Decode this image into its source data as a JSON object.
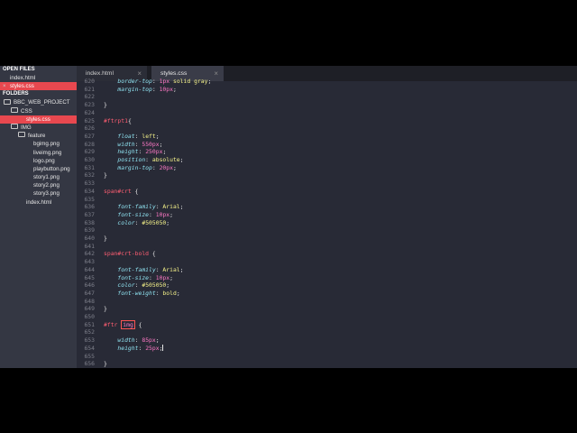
{
  "sidebar": {
    "open_files_header": "OPEN FILES",
    "open_files": [
      {
        "label": "index.html",
        "active": false
      },
      {
        "label": "styles.css",
        "active": true
      }
    ],
    "folders_header": "FOLDERS",
    "tree": [
      {
        "label": "BBC_WEB_PROJECT",
        "depth": 0,
        "type": "folder"
      },
      {
        "label": "CSS",
        "depth": 1,
        "type": "folder"
      },
      {
        "label": "styles.css",
        "depth": 2,
        "type": "file",
        "active": true
      },
      {
        "label": "IMG",
        "depth": 1,
        "type": "folder"
      },
      {
        "label": "feature",
        "depth": 2,
        "type": "folder"
      },
      {
        "label": "bgimg.png",
        "depth": 3,
        "type": "file"
      },
      {
        "label": "liveimg.png",
        "depth": 3,
        "type": "file"
      },
      {
        "label": "logo.png",
        "depth": 3,
        "type": "file"
      },
      {
        "label": "playbutton.png",
        "depth": 3,
        "type": "file"
      },
      {
        "label": "story1.png",
        "depth": 3,
        "type": "file"
      },
      {
        "label": "story2.png",
        "depth": 3,
        "type": "file"
      },
      {
        "label": "story3.png",
        "depth": 3,
        "type": "file"
      },
      {
        "label": "index.html",
        "depth": 2,
        "type": "file"
      }
    ]
  },
  "tabs": [
    {
      "label": "index.html",
      "active": false,
      "close": "×"
    },
    {
      "label": "styles.css",
      "active": true,
      "close": "×"
    }
  ],
  "editor": {
    "lines": [
      {
        "n": "620",
        "tokens": [
          [
            "prop",
            "    border-top"
          ],
          [
            "punc",
            ": "
          ],
          [
            "num",
            "1"
          ],
          [
            "unit",
            "px"
          ],
          [
            "val",
            " solid gray"
          ],
          [
            "punc",
            ";"
          ]
        ]
      },
      {
        "n": "621",
        "tokens": [
          [
            "prop",
            "    margin-top"
          ],
          [
            "punc",
            ": "
          ],
          [
            "num",
            "10"
          ],
          [
            "unit",
            "px"
          ],
          [
            "punc",
            ";"
          ]
        ]
      },
      {
        "n": "622",
        "tokens": []
      },
      {
        "n": "623",
        "tokens": [
          [
            "punc",
            "}"
          ]
        ]
      },
      {
        "n": "624",
        "tokens": []
      },
      {
        "n": "625",
        "tokens": [
          [
            "sel",
            "#ftrpt1"
          ],
          [
            "punc",
            "{"
          ]
        ]
      },
      {
        "n": "626",
        "tokens": []
      },
      {
        "n": "627",
        "tokens": [
          [
            "prop",
            "    float"
          ],
          [
            "punc",
            ": "
          ],
          [
            "val",
            "left"
          ],
          [
            "punc",
            ";"
          ]
        ]
      },
      {
        "n": "628",
        "tokens": [
          [
            "prop",
            "    width"
          ],
          [
            "punc",
            ": "
          ],
          [
            "num",
            "550"
          ],
          [
            "unit",
            "px"
          ],
          [
            "punc",
            ";"
          ]
        ]
      },
      {
        "n": "629",
        "tokens": [
          [
            "prop",
            "    height"
          ],
          [
            "punc",
            ": "
          ],
          [
            "num",
            "250"
          ],
          [
            "unit",
            "px"
          ],
          [
            "punc",
            ";"
          ]
        ]
      },
      {
        "n": "630",
        "tokens": [
          [
            "prop",
            "    position"
          ],
          [
            "punc",
            ": "
          ],
          [
            "val",
            "absolute"
          ],
          [
            "punc",
            ";"
          ]
        ]
      },
      {
        "n": "631",
        "tokens": [
          [
            "prop",
            "    margin-top"
          ],
          [
            "punc",
            ": "
          ],
          [
            "num",
            "20"
          ],
          [
            "unit",
            "px"
          ],
          [
            "punc",
            ";"
          ]
        ]
      },
      {
        "n": "632",
        "tokens": [
          [
            "punc",
            "}"
          ]
        ]
      },
      {
        "n": "633",
        "tokens": []
      },
      {
        "n": "634",
        "tokens": [
          [
            "sel",
            "span#crt"
          ],
          [
            "punc",
            " {"
          ]
        ]
      },
      {
        "n": "635",
        "tokens": []
      },
      {
        "n": "636",
        "tokens": [
          [
            "prop",
            "    font-family"
          ],
          [
            "punc",
            ": "
          ],
          [
            "val",
            "Arial"
          ],
          [
            "punc",
            ";"
          ]
        ]
      },
      {
        "n": "637",
        "tokens": [
          [
            "prop",
            "    font-size"
          ],
          [
            "punc",
            ": "
          ],
          [
            "num",
            "10"
          ],
          [
            "unit",
            "px"
          ],
          [
            "punc",
            ";"
          ]
        ]
      },
      {
        "n": "638",
        "tokens": [
          [
            "prop",
            "    color"
          ],
          [
            "punc",
            ": "
          ],
          [
            "val",
            "#505050"
          ],
          [
            "punc",
            ";"
          ]
        ]
      },
      {
        "n": "639",
        "tokens": []
      },
      {
        "n": "640",
        "tokens": [
          [
            "punc",
            "}"
          ]
        ]
      },
      {
        "n": "641",
        "tokens": []
      },
      {
        "n": "642",
        "tokens": [
          [
            "sel",
            "span#crt-bold"
          ],
          [
            "punc",
            " {"
          ]
        ]
      },
      {
        "n": "643",
        "tokens": []
      },
      {
        "n": "644",
        "tokens": [
          [
            "prop",
            "    font-family"
          ],
          [
            "punc",
            ": "
          ],
          [
            "val",
            "Arial"
          ],
          [
            "punc",
            ";"
          ]
        ]
      },
      {
        "n": "645",
        "tokens": [
          [
            "prop",
            "    font-size"
          ],
          [
            "punc",
            ": "
          ],
          [
            "num",
            "10"
          ],
          [
            "unit",
            "px"
          ],
          [
            "punc",
            ";"
          ]
        ]
      },
      {
        "n": "646",
        "tokens": [
          [
            "prop",
            "    color"
          ],
          [
            "punc",
            ": "
          ],
          [
            "val",
            "#505050"
          ],
          [
            "punc",
            ";"
          ]
        ]
      },
      {
        "n": "647",
        "tokens": [
          [
            "prop",
            "    font-weight"
          ],
          [
            "punc",
            ": "
          ],
          [
            "val",
            "bold"
          ],
          [
            "punc",
            ";"
          ]
        ]
      },
      {
        "n": "648",
        "tokens": []
      },
      {
        "n": "649",
        "tokens": [
          [
            "punc",
            "}"
          ]
        ]
      },
      {
        "n": "650",
        "tokens": []
      },
      {
        "n": "651",
        "tokens": [
          [
            "sel",
            "#ftr "
          ],
          [
            "tag",
            "img"
          ],
          [
            "punc",
            " {"
          ]
        ]
      },
      {
        "n": "652",
        "tokens": []
      },
      {
        "n": "653",
        "tokens": [
          [
            "prop",
            "    width"
          ],
          [
            "punc",
            ": "
          ],
          [
            "num",
            "85"
          ],
          [
            "unit",
            "px"
          ],
          [
            "punc",
            ";"
          ]
        ]
      },
      {
        "n": "654",
        "tokens": [
          [
            "prop",
            "    height"
          ],
          [
            "punc",
            ": "
          ],
          [
            "num",
            "25"
          ],
          [
            "unit",
            "px"
          ],
          [
            "punc",
            ";"
          ],
          [
            "caret",
            ""
          ]
        ]
      },
      {
        "n": "655",
        "tokens": []
      },
      {
        "n": "656",
        "tokens": [
          [
            "punc",
            "}"
          ]
        ]
      }
    ]
  },
  "colors": {
    "accent": "#e8484f",
    "editor_bg": "#282a36",
    "sidebar_bg": "#343743",
    "property": "#8fe2f0",
    "value": "#f6f38a",
    "number": "#ff79c6",
    "selector": "#ff5e72"
  }
}
